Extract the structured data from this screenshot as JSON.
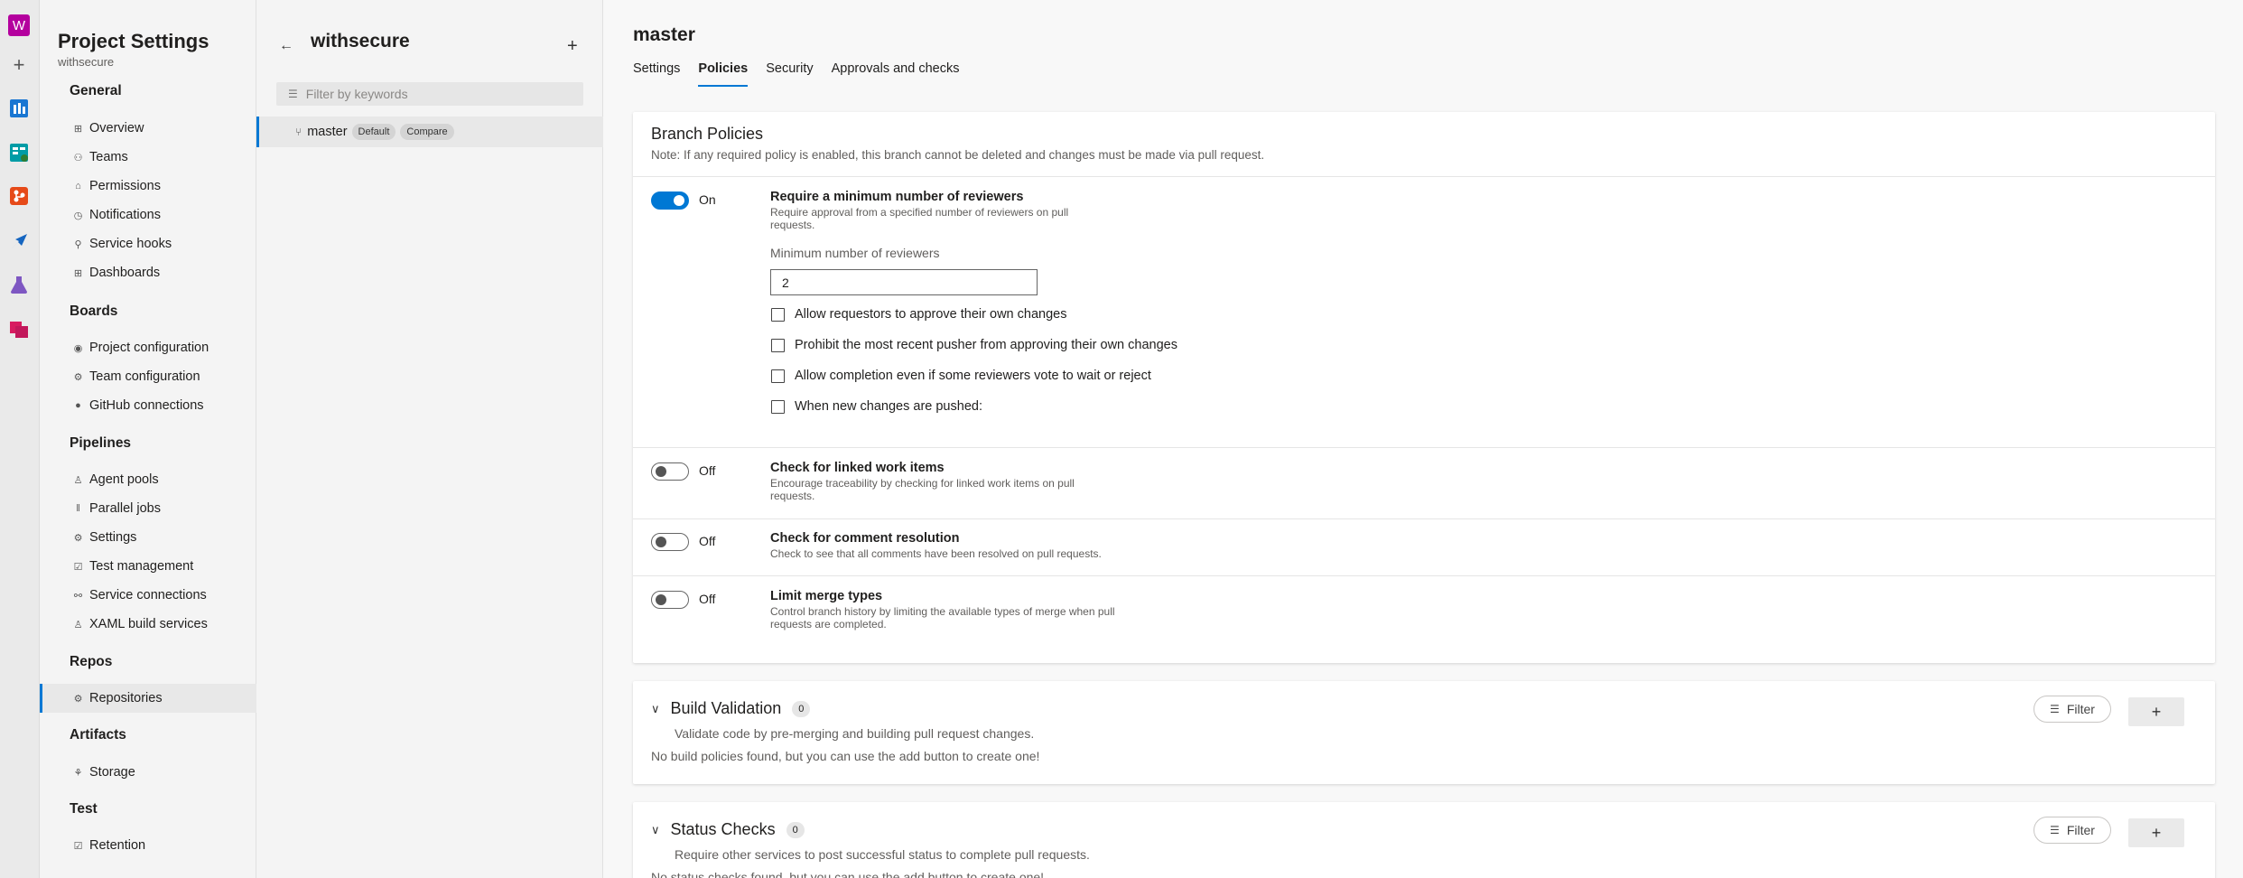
{
  "rail": {
    "org_letter": "W",
    "plus": "+",
    "icons": [
      "overview-icon",
      "boards-icon",
      "repos-icon",
      "pipelines-icon",
      "test-plans-icon",
      "artifacts-icon"
    ]
  },
  "nav": {
    "title": "Project Settings",
    "subtitle": "withsecure",
    "sections": {
      "general": "General",
      "boards": "Boards",
      "pipelines": "Pipelines",
      "repos": "Repos",
      "artifacts": "Artifacts",
      "test": "Test"
    },
    "items": {
      "overview": "Overview",
      "teams": "Teams",
      "permissions": "Permissions",
      "notifications": "Notifications",
      "service_hooks": "Service hooks",
      "dashboards": "Dashboards",
      "project_configuration": "Project configuration",
      "team_configuration": "Team configuration",
      "github_connections": "GitHub connections",
      "agent_pools": "Agent pools",
      "parallel_jobs": "Parallel jobs",
      "settings": "Settings",
      "test_management": "Test management",
      "service_connections": "Service connections",
      "xaml_build_services": "XAML build services",
      "repositories": "Repositories",
      "storage": "Storage",
      "retention": "Retention"
    }
  },
  "repo": {
    "title": "withsecure",
    "filter_placeholder": "Filter by keywords",
    "branch": "master",
    "default_badge": "Default",
    "compare_badge": "Compare"
  },
  "main": {
    "title": "master",
    "tabs": [
      "Settings",
      "Policies",
      "Security",
      "Approvals and checks"
    ],
    "active_tab": "Policies"
  },
  "branch_policies": {
    "title": "Branch Policies",
    "note": "Note: If any required policy is enabled, this branch cannot be deleted and changes must be made via pull request.",
    "min_reviewers": {
      "state": "On",
      "title": "Require a minimum number of reviewers",
      "desc": "Require approval from a specified number of reviewers on pull requests.",
      "count_label": "Minimum number of reviewers",
      "count_value": "2",
      "options": [
        "Allow requestors to approve their own changes",
        "Prohibit the most recent pusher from approving their own changes",
        "Allow completion even if some reviewers vote to wait or reject",
        "When new changes are pushed:"
      ]
    },
    "linked_work_items": {
      "state": "Off",
      "title": "Check for linked work items",
      "desc": "Encourage traceability by checking for linked work items on pull requests."
    },
    "comment_resolution": {
      "state": "Off",
      "title": "Check for comment resolution",
      "desc": "Check to see that all comments have been resolved on pull requests."
    },
    "merge_types": {
      "state": "Off",
      "title": "Limit merge types",
      "desc": "Control branch history by limiting the available types of merge when pull requests are completed."
    }
  },
  "build_validation": {
    "title": "Build Validation",
    "count": "0",
    "desc": "Validate code by pre-merging and building pull request changes.",
    "empty": "No build policies found, but you can use the add button to create one!",
    "filter": "Filter",
    "add": "+"
  },
  "status_checks": {
    "title": "Status Checks",
    "count": "0",
    "desc": "Require other services to post successful status to complete pull requests.",
    "empty": "No status checks found, but you can use the add button to create one!",
    "filter": "Filter",
    "add": "+"
  },
  "colors": {
    "accent": "#0078d4",
    "org": "#b4009e"
  }
}
